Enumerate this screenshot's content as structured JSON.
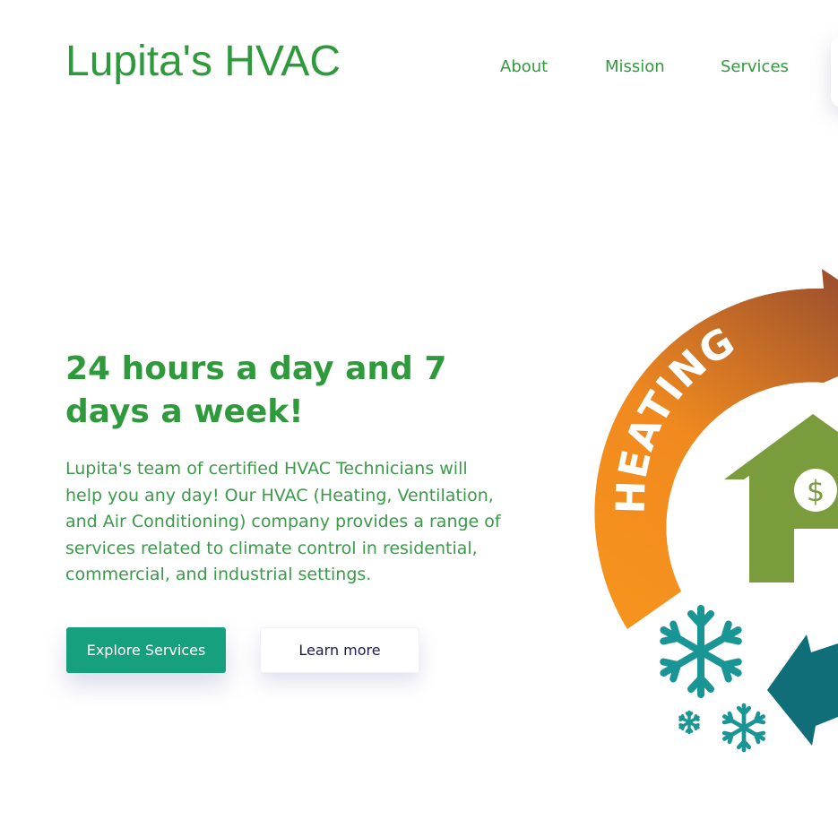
{
  "header": {
    "logo": "Lupita's HVAC",
    "nav": [
      {
        "label": "About"
      },
      {
        "label": "Mission"
      },
      {
        "label": "Services"
      }
    ]
  },
  "hero": {
    "heading": "24 hours a day and 7 days a week!",
    "text": "Lupita's team of certified HVAC Technicians will help you any day! Our HVAC (Heating, Ventilation, and Air Conditioning) company provides a range of services related to climate control in residential, commercial, and industrial settings.",
    "primary_button": "Explore Services",
    "secondary_button": "Learn more"
  },
  "illustration": {
    "arc_label": "HEATING",
    "currency_symbol": "$",
    "colors": {
      "heating_start": "#f7941d",
      "heating_end": "#a0522d",
      "house": "#7a9c3c",
      "snowflake": "#1a9595",
      "cooling_arrow": "#0f6e78"
    }
  }
}
